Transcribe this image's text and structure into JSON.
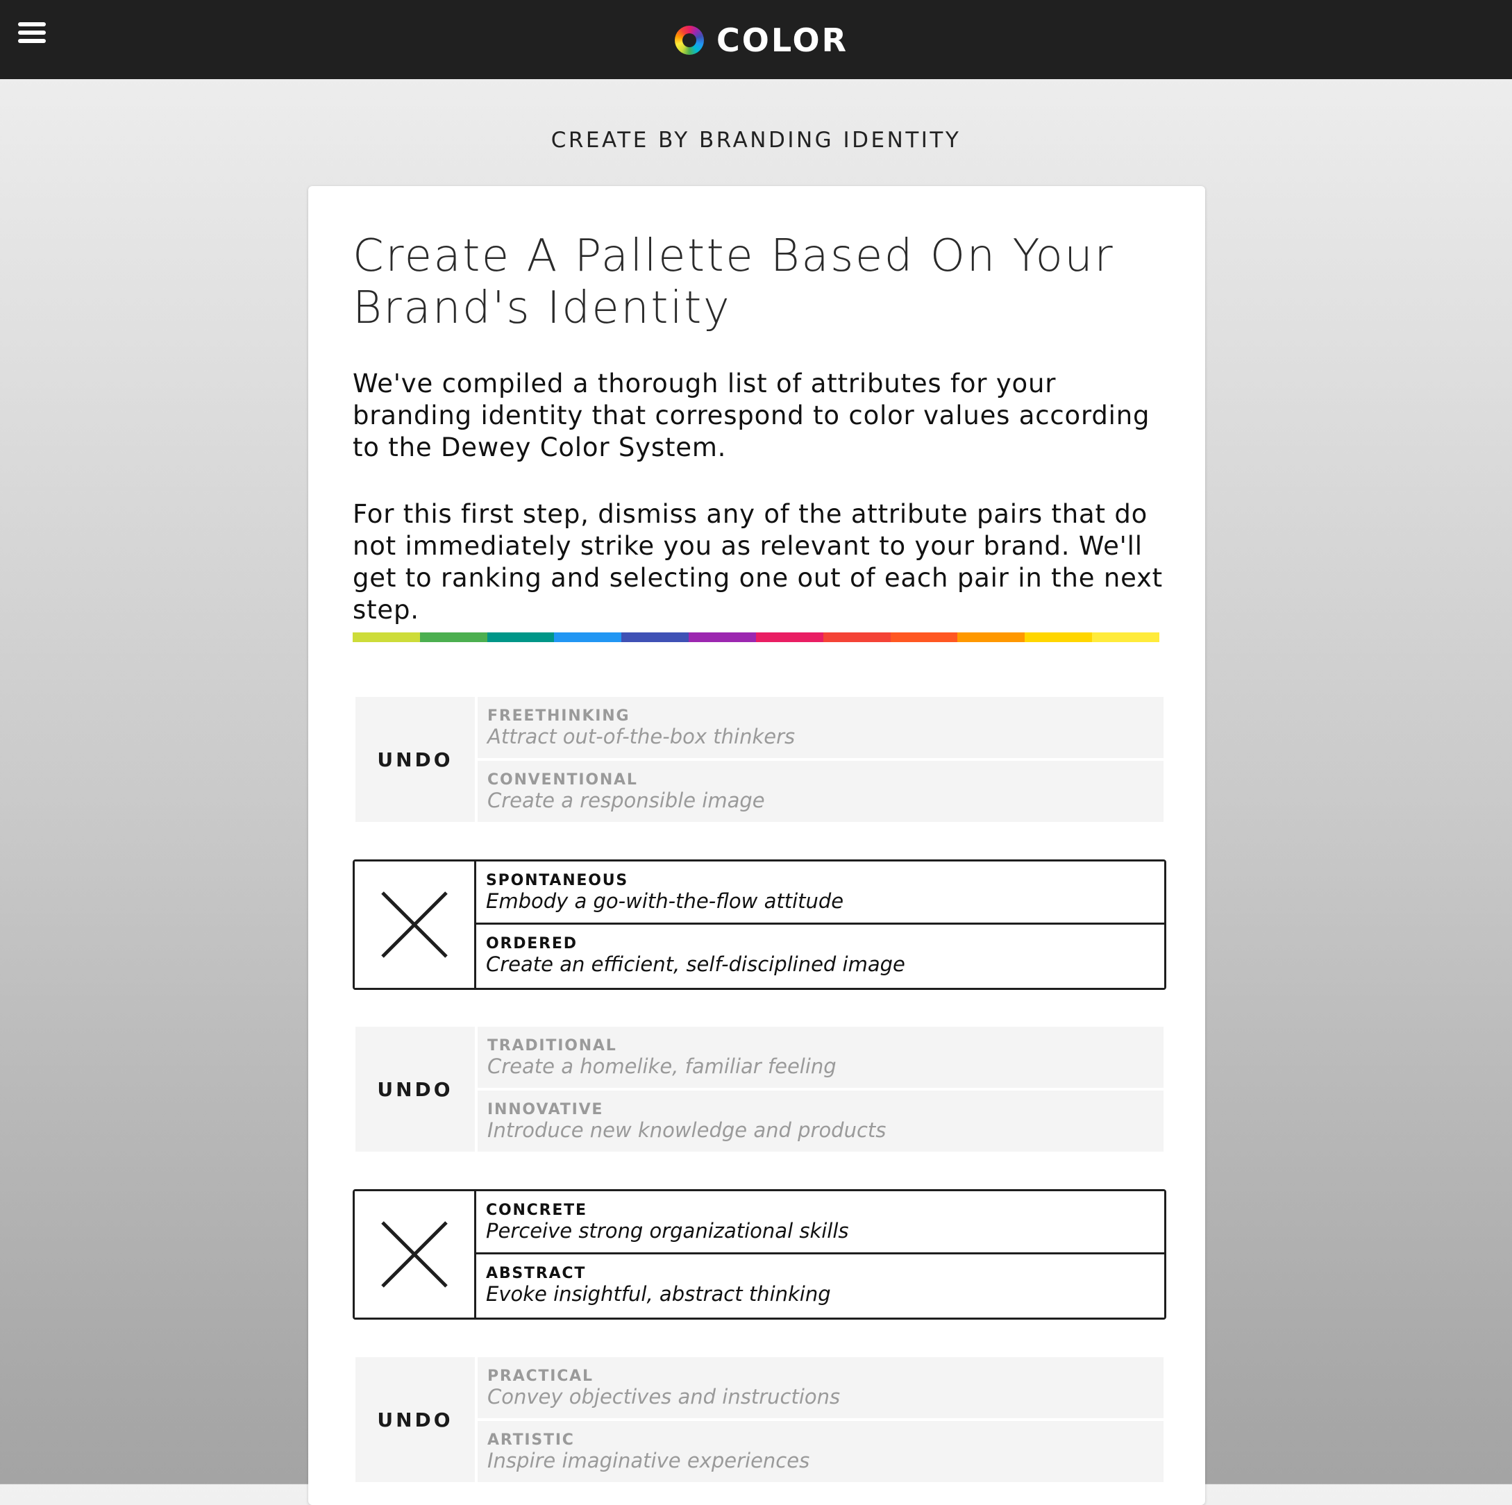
{
  "header": {
    "brand_name": "COLOR",
    "menu_icon": "hamburger-menu-icon",
    "logo_icon": "color-wheel-icon"
  },
  "page": {
    "heading": "CREATE BY BRANDING IDENTITY"
  },
  "card": {
    "title_line1": "Create A Pallette Based On Your",
    "title_line2": "Brand's Identity",
    "desc_1": "We've compiled a thorough list of attributes for your branding identity that correspond to color values according to the Dewey Color System.",
    "desc_2": "For this first step, dismiss any of the attribute pairs that do not immediately strike you as relevant to your brand. We'll get to ranking and selecting one out of each pair in the next step."
  },
  "color_strip": [
    "#cddc39",
    "#4caf50",
    "#009688",
    "#2196f3",
    "#3f51b5",
    "#9c27b0",
    "#e91e63",
    "#f44336",
    "#ff5722",
    "#ff9800",
    "#ffd600",
    "#ffeb3b"
  ],
  "pairs": [
    {
      "state": "dismissed",
      "action_label": "UNDO",
      "option_a": {
        "name": "FREETHINKING",
        "description": "Attract out-of-the-box thinkers"
      },
      "option_b": {
        "name": "CONVENTIONAL",
        "description": "Create a responsible image"
      }
    },
    {
      "state": "active",
      "action_icon": "close-x-icon",
      "option_a": {
        "name": "SPONTANEOUS",
        "description": "Embody a go-with-the-flow attitude"
      },
      "option_b": {
        "name": "ORDERED",
        "description": "Create an efficient, self-disciplined image"
      }
    },
    {
      "state": "dismissed",
      "action_label": "UNDO",
      "option_a": {
        "name": "TRADITIONAL",
        "description": "Create a homelike, familiar feeling"
      },
      "option_b": {
        "name": "INNOVATIVE",
        "description": "Introduce new knowledge and products"
      }
    },
    {
      "state": "active",
      "action_icon": "close-x-icon",
      "option_a": {
        "name": "CONCRETE",
        "description": "Perceive strong organizational skills"
      },
      "option_b": {
        "name": "ABSTRACT",
        "description": "Evoke insightful, abstract thinking"
      }
    },
    {
      "state": "dismissed",
      "action_label": "UNDO",
      "option_a": {
        "name": "PRACTICAL",
        "description": "Convey objectives and instructions"
      },
      "option_b": {
        "name": "ARTISTIC",
        "description": "Inspire imaginative experiences"
      }
    }
  ]
}
